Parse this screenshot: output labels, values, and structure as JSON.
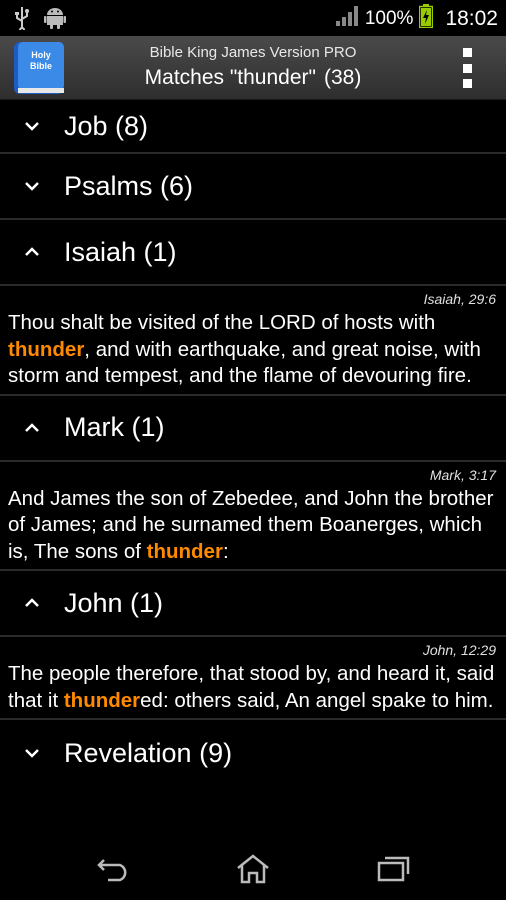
{
  "status": {
    "battery_pct": "100%",
    "time": "18:02",
    "icons": [
      "usb-icon",
      "android-icon",
      "signal-icon",
      "battery-charging-icon"
    ]
  },
  "actionbar": {
    "app_name": "Bible King James Version PRO",
    "title": "Matches \"thunder\"",
    "count": "(38)",
    "icon_text_line1": "Holy",
    "icon_text_line2": "Bible",
    "colors": {
      "icon_blue": "#2f7be0"
    }
  },
  "groups": {
    "job": {
      "label": "Job (8)",
      "expanded": false
    },
    "psalms": {
      "label": "Psalms (6)",
      "expanded": false
    },
    "isaiah": {
      "label": "Isaiah (1)",
      "expanded": true,
      "ref": "Isaiah, 29:6",
      "before": "Thou shalt be visited of the LORD of hosts with ",
      "match": "thunder",
      "after": ", and with earthquake, and great noise, with storm and tempest, and the flame of devouring fire."
    },
    "mark": {
      "label": "Mark (1)",
      "expanded": true,
      "ref": "Mark, 3:17",
      "before": "And James the son of Zebedee, and John the brother of James; and he surnamed them Boanerges, which is, The sons of ",
      "match": "thunder",
      "after": ":"
    },
    "john": {
      "label": "John (1)",
      "expanded": true,
      "ref": "John, 12:29",
      "before": "The people therefore, that stood by, and heard it, said that it ",
      "match": "thunder",
      "after": "ed: others said, An angel spake to him."
    },
    "revelation": {
      "label": "Revelation (9)",
      "expanded": false
    }
  },
  "highlight_color": "#ff8a00",
  "navbar": {
    "icons": [
      "back-icon",
      "home-icon",
      "recent-apps-icon"
    ]
  }
}
